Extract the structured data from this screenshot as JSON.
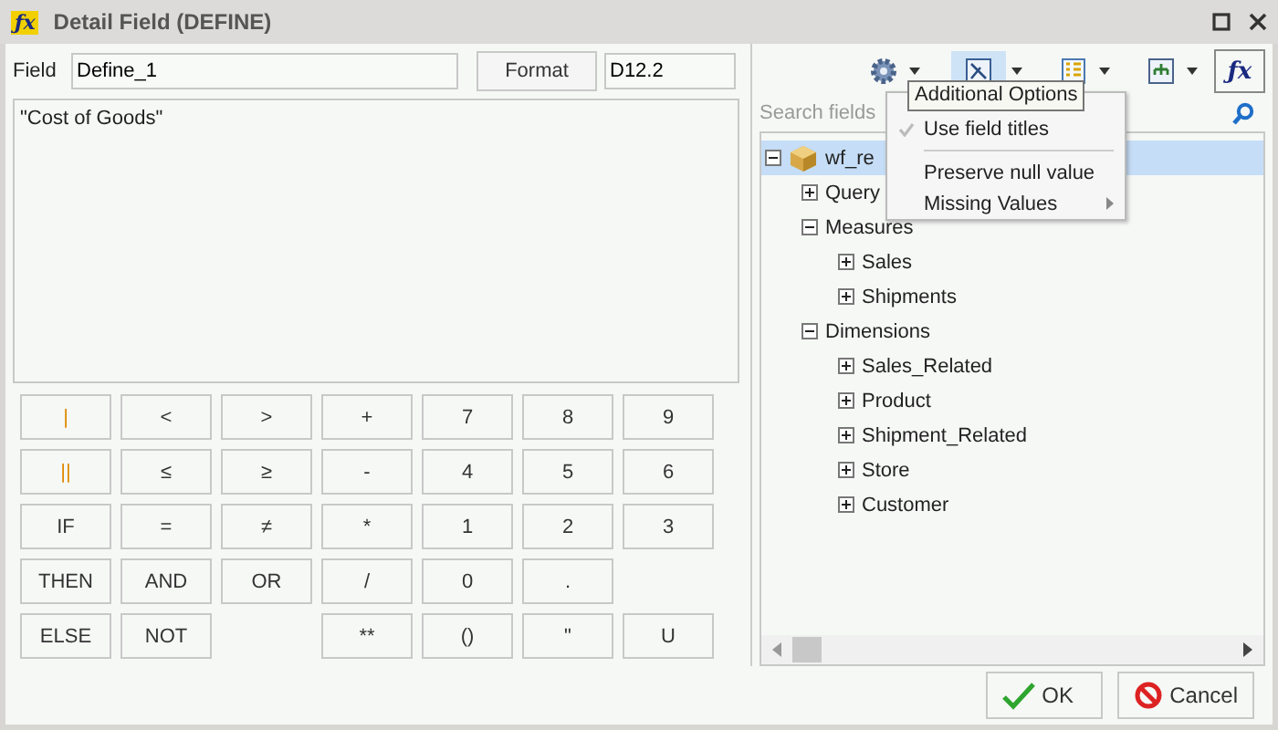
{
  "window": {
    "title": "Detail Field (DEFINE)",
    "logo": "ƒx"
  },
  "field": {
    "label": "Field",
    "value": "Define_1"
  },
  "format": {
    "button": "Format",
    "value": "D12.2"
  },
  "expression": "\"Cost of Goods\"",
  "keypad": [
    [
      {
        "label": "|",
        "kind": "operator"
      },
      {
        "label": "<",
        "kind": "key"
      },
      {
        "label": ">",
        "kind": "key"
      },
      {
        "label": "+",
        "kind": "key"
      },
      {
        "label": "7",
        "kind": "key"
      },
      {
        "label": "8",
        "kind": "key"
      },
      {
        "label": "9",
        "kind": "key"
      }
    ],
    [
      {
        "label": "||",
        "kind": "operator"
      },
      {
        "label": "≤",
        "kind": "key"
      },
      {
        "label": "≥",
        "kind": "key"
      },
      {
        "label": "-",
        "kind": "key"
      },
      {
        "label": "4",
        "kind": "key"
      },
      {
        "label": "5",
        "kind": "key"
      },
      {
        "label": "6",
        "kind": "key"
      }
    ],
    [
      {
        "label": "IF",
        "kind": "key"
      },
      {
        "label": "=",
        "kind": "key"
      },
      {
        "label": "≠",
        "kind": "key"
      },
      {
        "label": "*",
        "kind": "key"
      },
      {
        "label": "1",
        "kind": "key"
      },
      {
        "label": "2",
        "kind": "key"
      },
      {
        "label": "3",
        "kind": "key"
      }
    ],
    [
      {
        "label": "THEN",
        "kind": "key"
      },
      {
        "label": "AND",
        "kind": "key"
      },
      {
        "label": "OR",
        "kind": "key"
      },
      {
        "label": "/",
        "kind": "key"
      },
      {
        "label": "0",
        "kind": "key"
      },
      {
        "label": ".",
        "kind": "key"
      }
    ],
    [
      {
        "label": "ELSE",
        "kind": "key"
      },
      {
        "label": "NOT",
        "kind": "key"
      },
      {
        "kind": "blank"
      },
      {
        "label": "**",
        "kind": "key"
      },
      {
        "label": "()",
        "kind": "key"
      },
      {
        "label": "\"",
        "kind": "key"
      },
      {
        "label": "U",
        "kind": "key"
      }
    ]
  ],
  "toolbar": [
    {
      "kind": "gear",
      "highlighted": false
    },
    {
      "kind": "diagram",
      "highlighted": true
    },
    {
      "kind": "list",
      "highlighted": false
    },
    {
      "kind": "hierarchy",
      "highlighted": false
    },
    {
      "kind": "fx",
      "label": "ƒx",
      "highlighted": false
    }
  ],
  "search": {
    "placeholder": "Search fields"
  },
  "tree": [
    {
      "label": "wf_re",
      "expanded": true,
      "selected": true,
      "kind": "cube",
      "children": [
        {
          "label": "Query",
          "expanded": false,
          "selected": false
        },
        {
          "label": "Measures",
          "expanded": true,
          "selected": false,
          "children": [
            {
              "label": "Sales",
              "expanded": false,
              "selected": false
            },
            {
              "label": "Shipments",
              "expanded": false,
              "selected": false
            }
          ]
        },
        {
          "label": "Dimensions",
          "expanded": true,
          "selected": false,
          "children": [
            {
              "label": "Sales_Related",
              "expanded": false,
              "selected": false
            },
            {
              "label": "Product",
              "expanded": false,
              "selected": false
            },
            {
              "label": "Shipment_Related",
              "expanded": false,
              "selected": false
            },
            {
              "label": "Store",
              "expanded": false,
              "selected": false
            },
            {
              "label": "Customer",
              "expanded": false,
              "selected": false
            }
          ]
        }
      ]
    }
  ],
  "menu": [
    {
      "label": "Use field titles",
      "checked": true,
      "kind": "item"
    },
    {
      "kind": "separator"
    },
    {
      "label": "Preserve null value",
      "checked": false,
      "kind": "item"
    },
    {
      "label": "Missing Values",
      "checked": false,
      "kind": "submenu"
    }
  ],
  "tooltip": "Additional Options",
  "buttons": [
    {
      "label": "OK",
      "kind": "ok"
    },
    {
      "label": "Cancel",
      "kind": "cancel"
    }
  ]
}
